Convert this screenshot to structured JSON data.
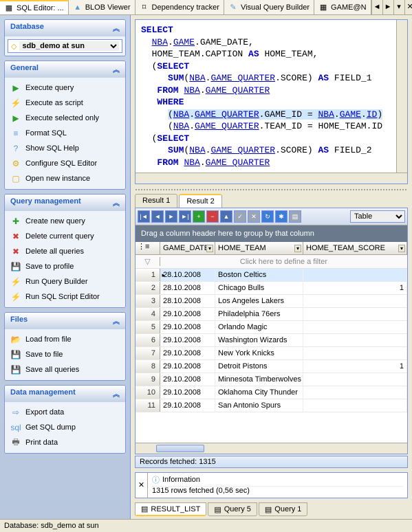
{
  "top_tabs": {
    "active": "SQL Editor: ...",
    "items": [
      {
        "label": "SQL Editor: ...",
        "icon_color": "#4a8"
      },
      {
        "label": "BLOB Viewer",
        "icon_color": "#5b9bd5"
      },
      {
        "label": "Dependency tracker",
        "icon_color": "#999"
      },
      {
        "label": "Visual Query Builder",
        "icon_color": "#5b9bd5"
      },
      {
        "label": "GAME@N",
        "icon_color": "#4a8"
      }
    ]
  },
  "sidebar": {
    "database": {
      "title": "Database",
      "selected": "sdb_demo at sun"
    },
    "general": {
      "title": "General",
      "items": [
        {
          "label": "Execute query",
          "icon": "▶",
          "color": "#2e9e2e"
        },
        {
          "label": "Execute as script",
          "icon": "⚡",
          "color": "#e6a817"
        },
        {
          "label": "Execute selected only",
          "icon": "▶",
          "color": "#2e9e2e"
        },
        {
          "label": "Format SQL",
          "icon": "≡",
          "color": "#5b9bd5"
        },
        {
          "label": "Show SQL Help",
          "icon": "?",
          "color": "#5b9bd5"
        },
        {
          "label": "Configure SQL Editor",
          "icon": "⚙",
          "color": "#e6a817"
        },
        {
          "label": "Open new instance",
          "icon": "▢",
          "color": "#e6a817"
        }
      ]
    },
    "query_mgmt": {
      "title": "Query management",
      "items": [
        {
          "label": "Create new query",
          "icon": "✚",
          "color": "#2e9e2e"
        },
        {
          "label": "Delete current query",
          "icon": "✖",
          "color": "#d04040"
        },
        {
          "label": "Delete all queries",
          "icon": "✖",
          "color": "#d04040"
        },
        {
          "label": "Save to profile",
          "icon": "💾",
          "color": "#5b9bd5"
        },
        {
          "label": "Run Query Builder",
          "icon": "⚡",
          "color": "#e6a817"
        },
        {
          "label": "Run SQL Script Editor",
          "icon": "⚡",
          "color": "#e6a817"
        }
      ]
    },
    "files": {
      "title": "Files",
      "items": [
        {
          "label": "Load from file",
          "icon": "📂",
          "color": "#e6a817"
        },
        {
          "label": "Save to file",
          "icon": "💾",
          "color": "#5b9bd5"
        },
        {
          "label": "Save all queries",
          "icon": "💾",
          "color": "#5b9bd5"
        }
      ]
    },
    "data_mgmt": {
      "title": "Data management",
      "items": [
        {
          "label": "Export data",
          "icon": "⇨",
          "color": "#5b9bd5"
        },
        {
          "label": "Get SQL dump",
          "icon": "sql",
          "color": "#5b9bd5"
        },
        {
          "label": "Print data",
          "icon": "🖶",
          "color": "#666"
        }
      ]
    }
  },
  "sql": {
    "lines": [
      "SELECT",
      "  NBA.GAME.GAME_DATE,",
      "  HOME_TEAM.CAPTION AS HOME_TEAM,",
      "  (SELECT",
      "     SUM(NBA.GAME_QUARTER.SCORE) AS FIELD_1",
      "   FROM NBA.GAME_QUARTER",
      "   WHERE",
      "     (NBA.GAME_QUARTER.GAME_ID = NBA.GAME.ID)",
      "     (NBA.GAME_QUARTER.TEAM_ID = HOME_TEAM.ID",
      "  (SELECT",
      "     SUM(NBA.GAME_QUARTER.SCORE) AS FIELD_2",
      "   FROM NBA.GAME_QUARTER"
    ]
  },
  "result_tabs": {
    "items": [
      "Result 1",
      "Result 2"
    ],
    "active": "Result 2"
  },
  "grid": {
    "view_mode": "Table",
    "group_hint": "Drag a column header here to group by that column",
    "filter_hint": "Click here to define a filter",
    "columns": [
      "GAME_DATE",
      "HOME_TEAM",
      "HOME_TEAM_SCORE"
    ],
    "rows": [
      {
        "n": 1,
        "sel": true,
        "date": "28.10.2008",
        "team": "Boston Celtics",
        "score": ""
      },
      {
        "n": 2,
        "date": "28.10.2008",
        "team": "Chicago Bulls",
        "score": "1"
      },
      {
        "n": 3,
        "date": "28.10.2008",
        "team": "Los Angeles Lakers",
        "score": ""
      },
      {
        "n": 4,
        "date": "29.10.2008",
        "team": "Philadelphia 76ers",
        "score": ""
      },
      {
        "n": 5,
        "date": "29.10.2008",
        "team": "Orlando Magic",
        "score": ""
      },
      {
        "n": 6,
        "date": "29.10.2008",
        "team": "Washington Wizards",
        "score": ""
      },
      {
        "n": 7,
        "date": "29.10.2008",
        "team": "New York Knicks",
        "score": ""
      },
      {
        "n": 8,
        "date": "29.10.2008",
        "team": "Detroit Pistons",
        "score": "1"
      },
      {
        "n": 9,
        "date": "29.10.2008",
        "team": "Minnesota Timberwolves",
        "score": ""
      },
      {
        "n": 10,
        "date": "29.10.2008",
        "team": "Oklahoma City Thunder",
        "score": ""
      },
      {
        "n": 11,
        "date": "29.10.2008",
        "team": "San Antonio Spurs",
        "score": ""
      }
    ],
    "fetched_label": "Records fetched: 1315"
  },
  "info": {
    "title": "Information",
    "message": "1315 rows fetched (0,56 sec)"
  },
  "bottom_tabs": {
    "items": [
      "RESULT_LIST",
      "Query 5",
      "Query 1"
    ],
    "active": "RESULT_LIST"
  },
  "status_bar": "Database: sdb_demo at sun"
}
